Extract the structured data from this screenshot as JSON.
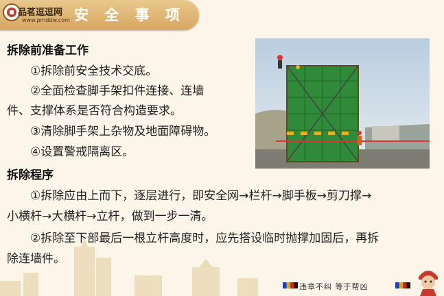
{
  "header": {
    "logo_title": "品茗逗逗网",
    "logo_url": "www.pmddw.com",
    "title": "安 全 事 项"
  },
  "content": {
    "section1_heading": "拆除前准备工作",
    "item1": "①拆除前安全技术交底。",
    "item2_line1": "②全面检查脚手架扣件连接、连墙",
    "item2_line2": "件、支撑体系是否符合构造要求。",
    "item3": "③清除脚手架上杂物及地面障碍物。",
    "item4": "④设置警戒隔离区。",
    "section2_heading": "拆除程序",
    "proc1_line1": "①拆除应由上而下，逐层进行，即安全网→栏杆→脚手板→剪刀撑→",
    "proc1_line2": "小横杆→大横杆→立杆，做到一步一清。",
    "proc2_line1": "②拆除至下部最后一根立杆高度时，应先搭设临时抛撑加固后，再拆",
    "proc2_line2": "除连墙件。"
  },
  "footer": {
    "slogan": "违章不纠  等于帮凶"
  },
  "colors": {
    "banner": "#d6a662",
    "background": "#fbf5ea",
    "net_green": "#2f8a3a",
    "warning_stripe": "#e8b21c"
  },
  "icons": [
    "logo-mark-icon",
    "mascot-icon"
  ]
}
